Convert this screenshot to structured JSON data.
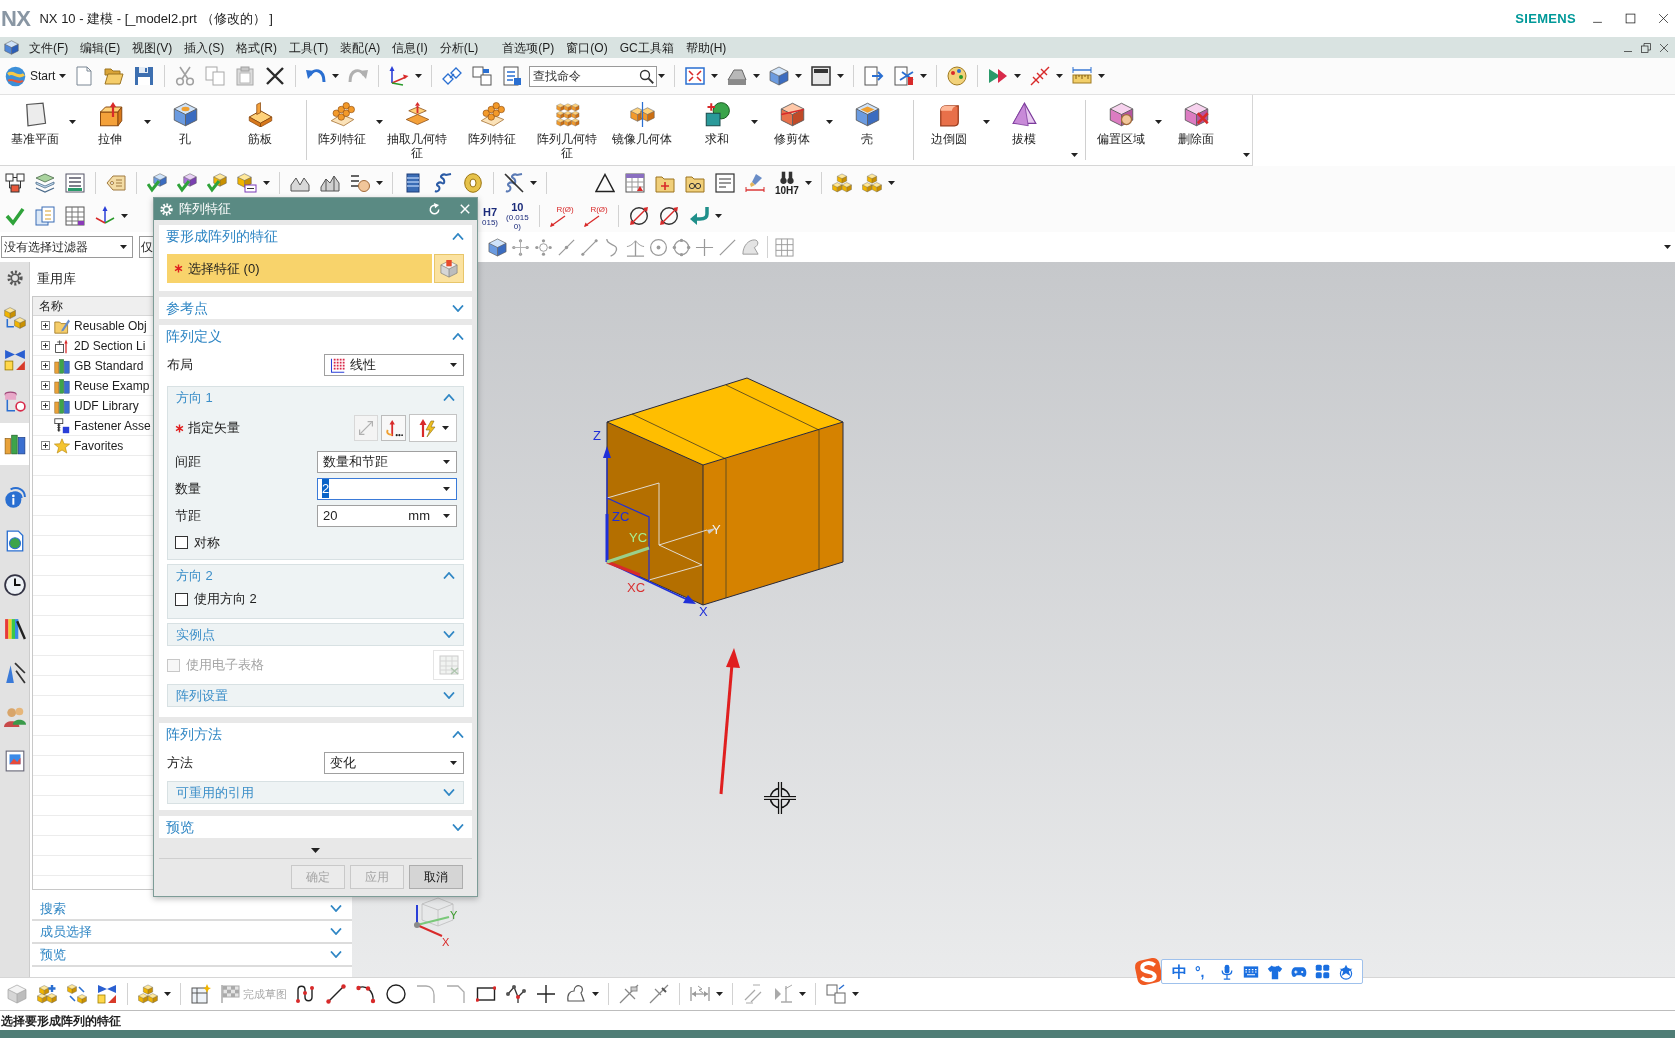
{
  "window": {
    "logo": "NX",
    "title": "NX 10 - 建模 - [_model2.prt （修改的） ]",
    "brand": "SIEMENS"
  },
  "menu_bar": [
    "文件(F)",
    "编辑(E)",
    "视图(V)",
    "插入(S)",
    "格式(R)",
    "工具(T)",
    "装配(A)",
    "信息(I)",
    "分析(L)",
    "首选项(P)",
    "窗口(O)",
    "GC工具箱",
    "帮助(H)"
  ],
  "toolbar": {
    "start": "Start",
    "search": {
      "placeholder": "查找命令"
    }
  },
  "ribbon": {
    "groups": [
      {
        "more_menu": false,
        "items": [
          {
            "label": "基准平面",
            "has_menu": true
          },
          {
            "label": "拉伸",
            "has_menu": true
          },
          {
            "label": "孔",
            "has_menu": false
          },
          {
            "label": "筋板",
            "has_menu": false
          }
        ]
      },
      {
        "more_menu": false,
        "items": [
          {
            "label": "阵列特征",
            "has_menu": true
          },
          {
            "label": "抽取几何特征",
            "has_menu": false
          },
          {
            "label": "阵列特征",
            "has_menu": false
          },
          {
            "label": "阵列几何特征",
            "has_menu": false
          },
          {
            "label": "镜像几何体",
            "has_menu": false
          },
          {
            "label": "求和",
            "has_menu": true
          },
          {
            "label": "修剪体",
            "has_menu": true
          },
          {
            "label": "壳",
            "has_menu": false
          }
        ]
      },
      {
        "more_menu": true,
        "items": [
          {
            "label": "边倒圆",
            "has_menu": true
          },
          {
            "label": "拔模",
            "has_menu": false
          }
        ]
      },
      {
        "more_menu": true,
        "items": [
          {
            "label": "偏置区域",
            "has_menu": true
          },
          {
            "label": "删除面",
            "has_menu": false
          }
        ]
      }
    ]
  },
  "tolerance_toolbar": {
    "fit_label": "10H7",
    "fit_tolerance": [
      "H7",
      "015)"
    ],
    "tolerance": [
      "10",
      "(0.015",
      "0)"
    ],
    "radius_labels": [
      "R(Ø)",
      "R(Ø)"
    ]
  },
  "selection_bar": {
    "filter": "没有选择过滤器",
    "scope": "仅"
  },
  "resource_bar": {
    "tabs": [
      {
        "selected": false
      },
      {
        "selected": false
      },
      {
        "selected": false
      },
      {
        "selected": true
      },
      {
        "selected": false
      },
      {
        "selected": false
      },
      {
        "selected": false
      },
      {
        "selected": false
      },
      {
        "selected": false
      },
      {
        "selected": false
      },
      {
        "selected": false
      }
    ]
  },
  "navigator": {
    "title": "重用库",
    "column": "名称",
    "items": [
      {
        "label": "Reusable Obj",
        "has_children": true,
        "expanded": false
      },
      {
        "label": "2D Section Li",
        "has_children": true,
        "expanded": false
      },
      {
        "label": "GB Standard",
        "has_children": true,
        "expanded": false
      },
      {
        "label": "Reuse Examp",
        "has_children": true,
        "expanded": false
      },
      {
        "label": "UDF Library",
        "has_children": true,
        "expanded": false
      },
      {
        "label": "Fastener Asse",
        "has_children": false
      },
      {
        "label": "Favorites",
        "has_children": true,
        "expanded": false
      }
    ],
    "panels": [
      {
        "label": "搜索",
        "expanded": false
      },
      {
        "label": "成员选择",
        "expanded": false
      },
      {
        "label": "预览",
        "expanded": false
      }
    ]
  },
  "dialog": {
    "title": "阵列特征",
    "sections": [
      {
        "kind": "select",
        "title": "要形成阵列的特征",
        "expanded": true,
        "select": {
          "label": "选择特征 (0)",
          "required": true
        }
      },
      {
        "kind": "plain",
        "title": "参考点",
        "expanded": false
      },
      {
        "kind": "definition",
        "title": "阵列定义",
        "expanded": true,
        "layout": {
          "label": "布局",
          "value": "线性"
        },
        "groups": [
          {
            "kind": "direction",
            "title": "方向 1",
            "expanded": true,
            "vector": {
              "label": "指定矢量",
              "required": true
            },
            "spacing": {
              "label": "间距",
              "value": "数量和节距"
            },
            "count": {
              "label": "数量",
              "value": "2",
              "highlighted": true
            },
            "pitch": {
              "label": "节距",
              "value": "20",
              "unit": "mm"
            },
            "symmetric": {
              "label": "对称",
              "checked": false
            }
          },
          {
            "kind": "toggle",
            "title": "方向 2",
            "expanded": true,
            "option": {
              "label": "使用方向 2",
              "checked": false
            }
          },
          {
            "kind": "plain",
            "title": "实例点",
            "expanded": false
          },
          {
            "kind": "spreadsheet",
            "label": "使用电子表格",
            "checked": false,
            "disabled": true
          },
          {
            "kind": "plain",
            "title": "阵列设置",
            "expanded": false
          }
        ]
      },
      {
        "kind": "method",
        "title": "阵列方法",
        "expanded": true,
        "method": {
          "label": "方法",
          "value": "变化"
        },
        "groups": [
          {
            "kind": "plain",
            "title": "可重用的引用",
            "expanded": false
          }
        ]
      },
      {
        "kind": "plain",
        "title": "预览",
        "expanded": false
      }
    ],
    "buttons": [
      {
        "label": "确定",
        "disabled": true
      },
      {
        "label": "应用",
        "disabled": true
      },
      {
        "label": "取消",
        "disabled": false
      }
    ]
  },
  "viewport": {
    "axis_labels": [
      "Z",
      "ZC",
      "YC",
      "Y",
      "XC",
      "X"
    ],
    "triad_labels": [
      "Y",
      "X"
    ]
  },
  "sketch_toolbar": {
    "finish_sketch": {
      "label": "完成草图",
      "disabled": true
    }
  },
  "status_bar": "选择要形成阵列的特征",
  "ime_bar": {
    "mode": "中",
    "punctuation": "°,"
  }
}
